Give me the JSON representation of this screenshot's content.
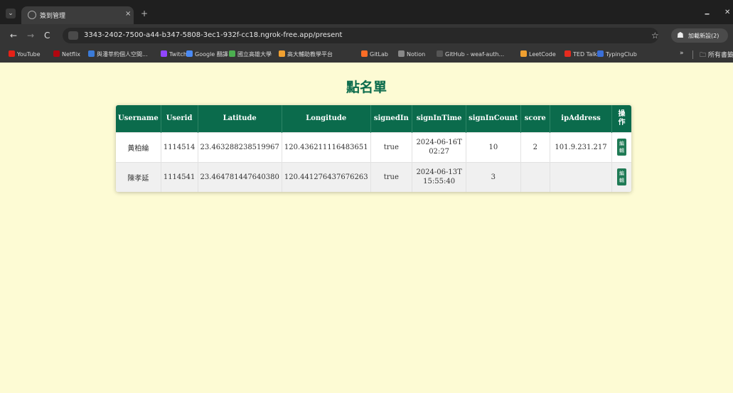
{
  "browser": {
    "tab_title": "簽到管理",
    "tab_close": "×",
    "new_tab": "+",
    "window_min": "🗕",
    "window_close": "✕",
    "nav_back": "←",
    "nav_forward": "→",
    "nav_reload": "C",
    "url": "3343-2402-7500-a44-b347-5808-3ec1-932f-cc18.ngrok-free.app/present",
    "star": "☆",
    "profile_label": "加載新設(2)",
    "bookmarks": [
      {
        "label": "YouTube",
        "color": "#e62117"
      },
      {
        "label": "Netflix",
        "color": "#b1060f"
      },
      {
        "label": "與潘莘約個人空間...",
        "color": "#3b7bd8"
      },
      {
        "label": "Twitch",
        "color": "#9146ff"
      },
      {
        "label": "Google 翻譯",
        "color": "#4a8af4"
      },
      {
        "label": "國立高雄大學",
        "color": "#4caf50"
      },
      {
        "label": "高大輔助教學平台",
        "color": "#f0a030"
      },
      {
        "label": "GitLab",
        "color": "#fc6d26"
      },
      {
        "label": "Notion",
        "color": "#888888"
      },
      {
        "label": "GitHub - weaf-auth...",
        "color": "#555555"
      },
      {
        "label": "LeetCode",
        "color": "#f0a030"
      },
      {
        "label": "TED Talk",
        "color": "#e62b1e"
      },
      {
        "label": "TypingClub",
        "color": "#3a6fd8"
      }
    ],
    "bookmarks_more": "»",
    "bookmarks_folder": "所有書籤"
  },
  "page": {
    "title": "點名單"
  },
  "table": {
    "headers": [
      "Username",
      "Userid",
      "Latitude",
      "Longitude",
      "signedIn",
      "signInTime",
      "signInCount",
      "score",
      "ipAddress",
      "操作"
    ],
    "rows": [
      {
        "username": "黃柏綸",
        "userid": "1114514",
        "latitude": "23.463288238519967",
        "longitude": "120.436211116483651",
        "signedIn": "true",
        "signInTime": "2024-06-16T02:27",
        "signInCount": "10",
        "score": "2",
        "ipAddress": "101.9.231.217",
        "action": "編輯"
      },
      {
        "username": "陳孝延",
        "userid": "1114541",
        "latitude": "23.464781447640380",
        "longitude": "120.441276437676263",
        "signedIn": "true",
        "signInTime": "2024-06-13T15:55:40",
        "signInCount": "3",
        "score": "",
        "ipAddress": "",
        "action": "編輯"
      }
    ]
  }
}
